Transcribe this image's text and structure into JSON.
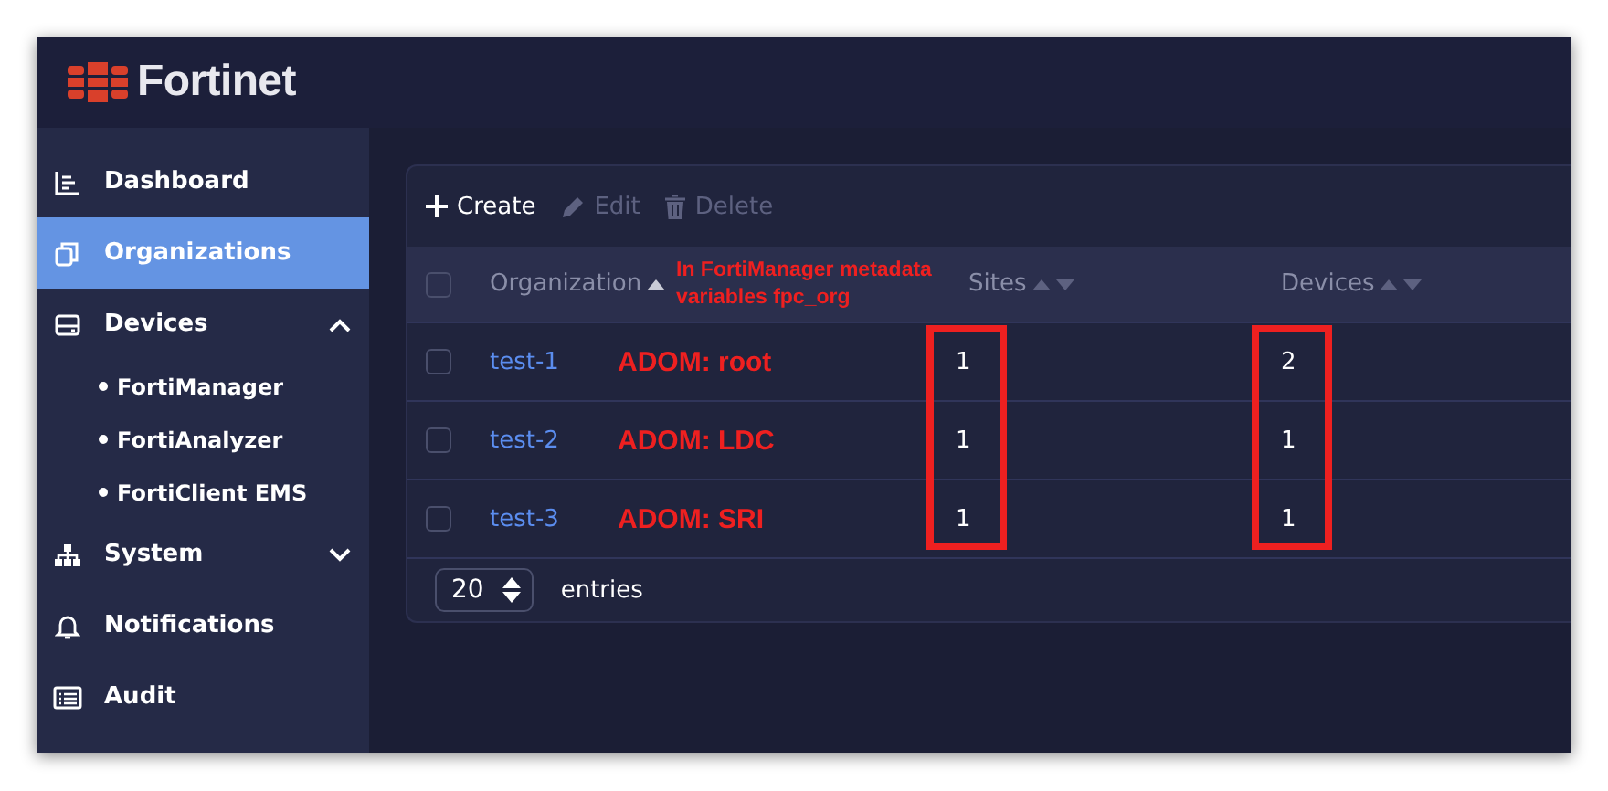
{
  "header": {
    "brand": "Fortinet"
  },
  "sidebar": {
    "items": [
      {
        "label": "Dashboard",
        "selected": false
      },
      {
        "label": "Organizations",
        "selected": true
      },
      {
        "label": "Devices",
        "selected": false,
        "expanded": true,
        "children": [
          {
            "label": "FortiManager"
          },
          {
            "label": "FortiAnalyzer"
          },
          {
            "label": "FortiClient EMS"
          }
        ]
      },
      {
        "label": "System",
        "selected": false,
        "expanded": false
      },
      {
        "label": "Notifications",
        "selected": false
      },
      {
        "label": "Audit",
        "selected": false
      }
    ]
  },
  "toolbar": [
    {
      "label": "Create",
      "disabled": false
    },
    {
      "label": "Edit",
      "disabled": true
    },
    {
      "label": "Delete",
      "disabled": true
    }
  ],
  "table": {
    "all_checked": false,
    "columns": [
      {
        "label": "Organization",
        "sorted": true,
        "highlighted": false
      },
      {
        "label": "Sites",
        "sorted": false,
        "highlighted": true
      },
      {
        "label": "Devices",
        "sorted": false,
        "highlighted": true
      }
    ],
    "header_annotation": "In FortiManager metadata variables fpc_org",
    "rows": [
      {
        "checked": false,
        "organization": "test-1",
        "annotation": "ADOM: root",
        "sites": "1",
        "devices": "2"
      },
      {
        "checked": false,
        "organization": "test-2",
        "annotation": "ADOM: LDC",
        "sites": "1",
        "devices": "1"
      },
      {
        "checked": false,
        "organization": "test-3",
        "annotation": "ADOM: SRI",
        "sites": "1",
        "devices": "1"
      }
    ]
  },
  "footer": {
    "page_size": "20",
    "label": "entries"
  }
}
